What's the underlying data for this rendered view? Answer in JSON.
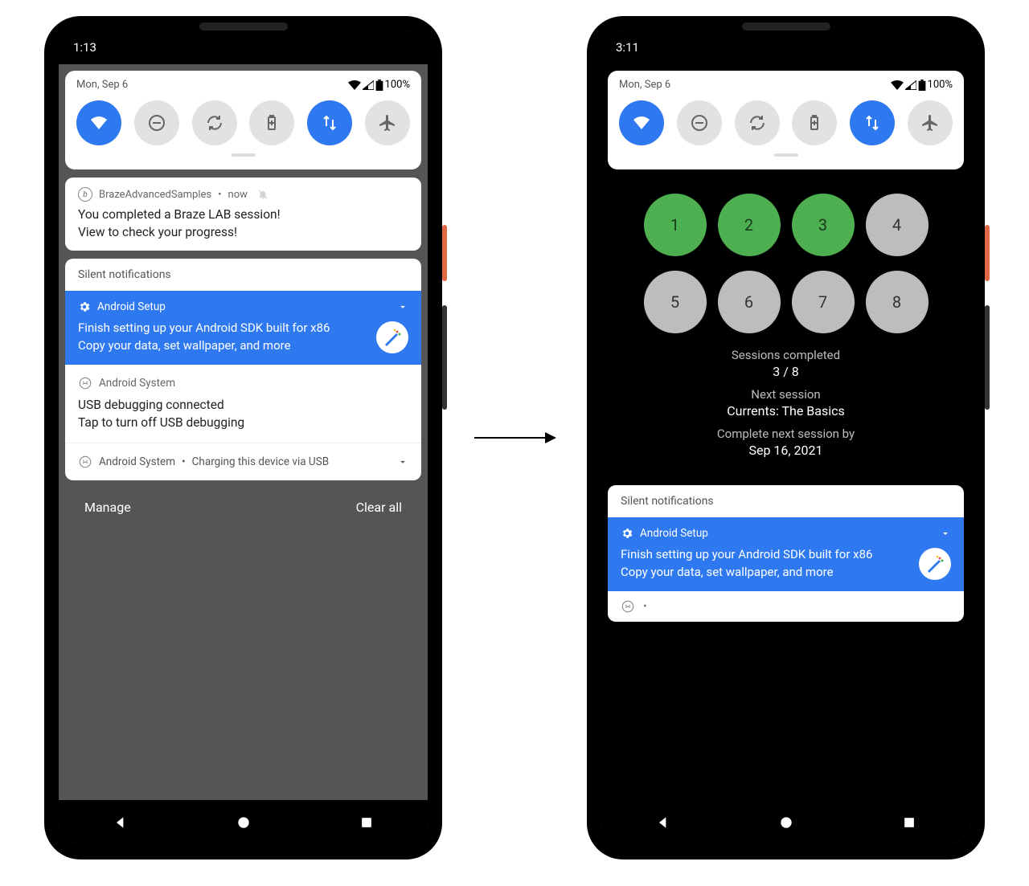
{
  "left": {
    "clock": "1:13",
    "date": "Mon, Sep 6",
    "battery_pct": "100%",
    "qs": [
      {
        "name": "wifi",
        "active": true
      },
      {
        "name": "dnd",
        "active": false
      },
      {
        "name": "rotate",
        "active": false
      },
      {
        "name": "battery-saver",
        "active": false
      },
      {
        "name": "mobile-data",
        "active": true
      },
      {
        "name": "airplane",
        "active": false
      }
    ],
    "braze": {
      "app": "BrazeAdvancedSamples",
      "when": "now",
      "title": "You completed a Braze LAB session!",
      "subtitle": "View to check your progress!"
    },
    "silent_header": "Silent notifications",
    "setup": {
      "heading": "Android Setup",
      "line1": "Finish setting up your Android SDK built for x86",
      "line2": "Copy your data, set wallpaper, and more"
    },
    "system": {
      "heading": "Android System",
      "title": "USB debugging connected",
      "subtitle": "Tap to turn off USB debugging"
    },
    "charging": {
      "heading": "Android System",
      "text": "Charging this device via USB"
    },
    "manage": "Manage",
    "clear_all": "Clear all"
  },
  "right": {
    "clock": "3:11",
    "date": "Mon, Sep 6",
    "battery_pct": "100%",
    "qs": [
      {
        "name": "wifi",
        "active": true
      },
      {
        "name": "dnd",
        "active": false
      },
      {
        "name": "rotate",
        "active": false
      },
      {
        "name": "battery-saver",
        "active": false
      },
      {
        "name": "mobile-data",
        "active": true
      },
      {
        "name": "airplane",
        "active": false
      }
    ],
    "progress": {
      "dots": [
        {
          "n": "1",
          "done": true
        },
        {
          "n": "2",
          "done": true
        },
        {
          "n": "3",
          "done": true
        },
        {
          "n": "4",
          "done": false
        },
        {
          "n": "5",
          "done": false
        },
        {
          "n": "6",
          "done": false
        },
        {
          "n": "7",
          "done": false
        },
        {
          "n": "8",
          "done": false
        }
      ],
      "sessions_label": "Sessions completed",
      "sessions_value": "3 / 8",
      "next_label": "Next session",
      "next_value": "Currents: The Basics",
      "by_label": "Complete next session by",
      "by_value": "Sep 16, 2021"
    },
    "silent_header": "Silent notifications",
    "setup": {
      "heading": "Android Setup",
      "line1": "Finish setting up your Android SDK built for x86",
      "line2": "Copy your data, set wallpaper, and more"
    }
  }
}
